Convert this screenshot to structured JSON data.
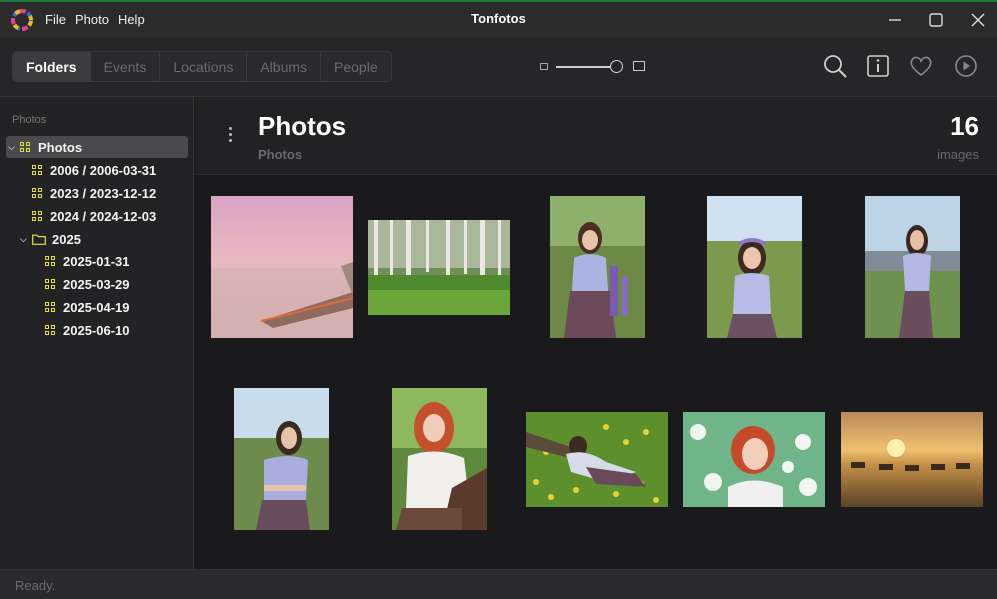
{
  "window": {
    "title": "Tonfotos"
  },
  "menu": [
    "File",
    "Photo",
    "Help"
  ],
  "tabs": [
    {
      "label": "Folders",
      "active": true
    },
    {
      "label": "Events",
      "active": false
    },
    {
      "label": "Locations",
      "active": false
    },
    {
      "label": "Albums",
      "active": false
    },
    {
      "label": "People",
      "active": false
    }
  ],
  "zoom": {
    "level": 0.9
  },
  "toolbar_icons": [
    "search-icon",
    "info-icon",
    "heart-icon",
    "play-icon"
  ],
  "sidebar": {
    "header": "Photos",
    "items": [
      {
        "label": "Photos",
        "icon": "grid-icon",
        "expanded": true,
        "selected": true
      },
      {
        "label": "2006 / 2006-03-31",
        "icon": "grid-icon"
      },
      {
        "label": "2023 / 2023-12-12",
        "icon": "grid-icon"
      },
      {
        "label": "2024 / 2024-12-03",
        "icon": "grid-icon"
      },
      {
        "label": "2025",
        "icon": "folder-icon",
        "expanded": true
      },
      {
        "label": "2025-01-31",
        "icon": "grid-icon"
      },
      {
        "label": "2025-03-29",
        "icon": "grid-icon"
      },
      {
        "label": "2025-04-19",
        "icon": "grid-icon"
      },
      {
        "label": "2025-06-10",
        "icon": "grid-icon"
      }
    ]
  },
  "main": {
    "title": "Photos",
    "subtitle": "Photos",
    "count": "16",
    "count_label": "images"
  },
  "photos": [
    {
      "subject": "pink-sea-pier"
    },
    {
      "subject": "birch-forest"
    },
    {
      "subject": "woman-lupines"
    },
    {
      "subject": "woman-flower-wreath"
    },
    {
      "subject": "woman-meadow"
    },
    {
      "subject": "woman-crossed-arms"
    },
    {
      "subject": "redhead-tree"
    },
    {
      "subject": "woman-dandelions"
    },
    {
      "subject": "redhead-blossoms"
    },
    {
      "subject": "horses-sunset"
    }
  ],
  "status": {
    "text": "Ready."
  },
  "colors": {
    "accent_yellow": "#e6df3a",
    "background": "#1a1a1c",
    "selected": "#4a4a4d"
  }
}
